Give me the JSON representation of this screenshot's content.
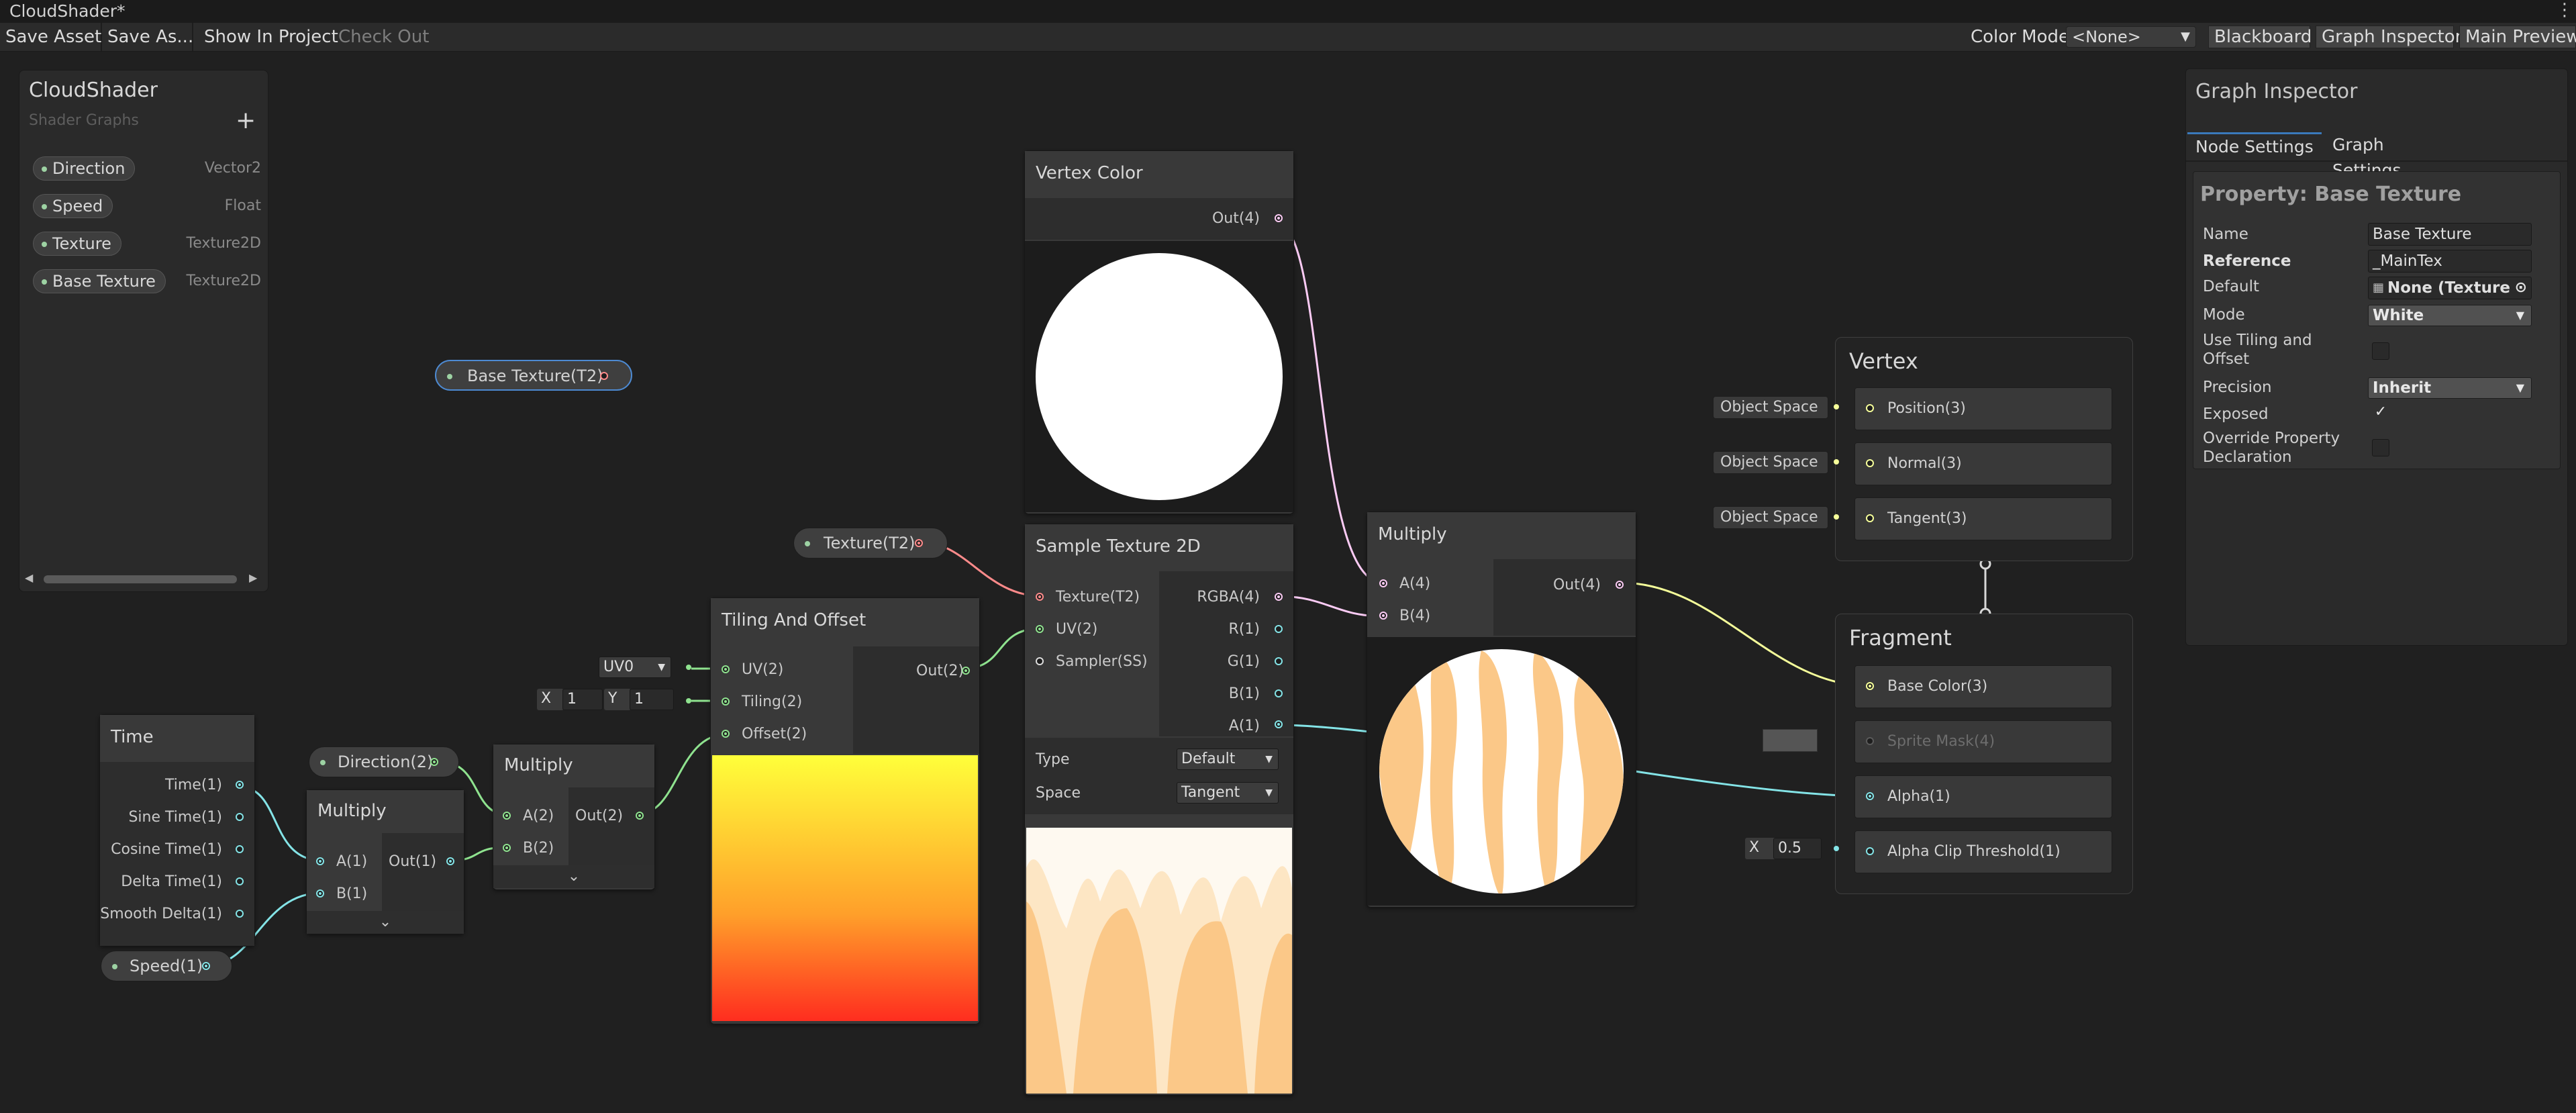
{
  "window": {
    "title": "CloudShader*"
  },
  "toolbar": {
    "save_asset": "Save Asset",
    "save_as": "Save As...",
    "show_in_project": "Show In Project",
    "check_out": "Check Out",
    "color_mode_label": "Color Mode",
    "color_mode_value": "<None>",
    "blackboard": "Blackboard",
    "graph_inspector": "Graph Inspector",
    "main_preview": "Main Preview"
  },
  "blackboard": {
    "title": "CloudShader",
    "subtitle": "Shader Graphs",
    "add": "+",
    "properties": [
      {
        "name": "Direction",
        "type": "Vector2"
      },
      {
        "name": "Speed",
        "type": "Float"
      },
      {
        "name": "Texture",
        "type": "Texture2D"
      },
      {
        "name": "Base Texture",
        "type": "Texture2D"
      }
    ]
  },
  "graph": {
    "base_texture_pill": "Base Texture(T2)",
    "texture_pill": "Texture(T2)",
    "direction_pill": "Direction(2)",
    "speed_pill": "Speed(1)",
    "time_node": {
      "title": "Time",
      "outputs": [
        "Time(1)",
        "Sine Time(1)",
        "Cosine Time(1)",
        "Delta Time(1)",
        "Smooth Delta(1)"
      ]
    },
    "multiply1": {
      "title": "Multiply",
      "inputs": [
        "A(1)",
        "B(1)"
      ],
      "output": "Out(1)"
    },
    "multiply2": {
      "title": "Multiply",
      "inputs": [
        "A(2)",
        "B(2)"
      ],
      "output": "Out(2)"
    },
    "tiling": {
      "title": "Tiling And Offset",
      "inputs": [
        "UV(2)",
        "Tiling(2)",
        "Offset(2)"
      ],
      "output": "Out(2)",
      "uv_channel": "UV0",
      "tiling_x_label": "X",
      "tiling_x": "1",
      "tiling_y_label": "Y",
      "tiling_y": "1"
    },
    "vertex_color": {
      "title": "Vertex Color",
      "output": "Out(4)"
    },
    "sample_texture": {
      "title": "Sample Texture 2D",
      "inputs": [
        "Texture(T2)",
        "UV(2)",
        "Sampler(SS)"
      ],
      "outputs": [
        "RGBA(4)",
        "R(1)",
        "G(1)",
        "B(1)",
        "A(1)"
      ],
      "type_label": "Type",
      "type_value": "Default",
      "space_label": "Space",
      "space_value": "Tangent"
    },
    "multiply3": {
      "title": "Multiply",
      "inputs": [
        "A(4)",
        "B(4)"
      ],
      "output": "Out(4)"
    },
    "vertex_ctx": {
      "title": "Vertex",
      "blocks": [
        "Position(3)",
        "Normal(3)",
        "Tangent(3)"
      ],
      "space": "Object Space"
    },
    "fragment_ctx": {
      "title": "Fragment",
      "blocks": [
        "Base Color(3)",
        "Sprite Mask(4)",
        "Alpha(1)",
        "Alpha Clip Threshold(1)"
      ],
      "alpha_clip_x_label": "X",
      "alpha_clip_value": "0.5"
    }
  },
  "inspector": {
    "title": "Graph Inspector",
    "tabs": [
      "Node Settings",
      "Graph Settings"
    ],
    "property_title": "Property: Base Texture",
    "rows": {
      "name_label": "Name",
      "name_value": "Base Texture",
      "reference_label": "Reference",
      "reference_value": "_MainTex",
      "default_label": "Default",
      "default_value": "None (Texture",
      "mode_label": "Mode",
      "mode_value": "White",
      "tiling_label_1": "Use Tiling and",
      "tiling_label_2": "Offset",
      "precision_label": "Precision",
      "precision_value": "Inherit",
      "exposed_label": "Exposed",
      "override_label_1": "Override Property",
      "override_label_2": "Declaration"
    }
  },
  "colors": {
    "vector2_port": "#8fe38f",
    "float_port": "#84e4e7",
    "vector4_port": "#fbcbf4",
    "vector3_port": "#f6ff9a",
    "texture_port": "#ff8b8b",
    "accent_tab": "#3a79bb"
  }
}
